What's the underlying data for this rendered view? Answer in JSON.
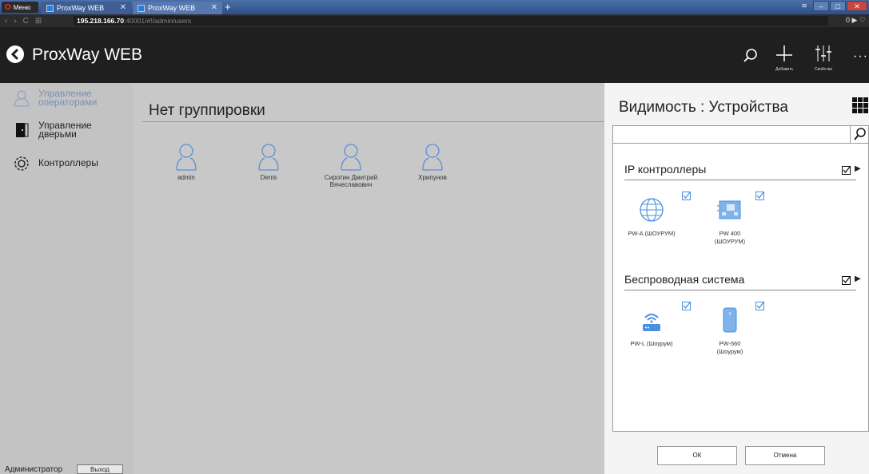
{
  "browser": {
    "menu_label": "Меню",
    "tabs": [
      {
        "title": "ProxWay WEB"
      },
      {
        "title": "ProxWay WEB"
      }
    ],
    "new_tab": "+",
    "address_host": "195.218.166.70",
    "address_rest": ":40001/#!/admin/users",
    "right_status": "0 ▶ ♡"
  },
  "header": {
    "title": "ProxWay WEB",
    "add_caption": "Добавить",
    "props_caption": "Свойства",
    "more": "···"
  },
  "sidebar": {
    "items": [
      {
        "label": "Управление операторами",
        "icon": "user-outline-icon"
      },
      {
        "label": "Управление дверьми",
        "icon": "door-icon"
      },
      {
        "label": "Контроллеры",
        "icon": "gear-icon"
      }
    ],
    "admin_label": "Администратор",
    "logout_label": "Выход"
  },
  "main": {
    "group_title": "Нет группировки",
    "users": [
      {
        "name": "admin"
      },
      {
        "name": "Denis"
      },
      {
        "name": "Сиротин Дмитрий Вячеславович"
      },
      {
        "name": "Хрипунов"
      }
    ]
  },
  "panel": {
    "title": "Видимость : Устройства",
    "search_placeholder": "",
    "sections": [
      {
        "title": "IP контроллеры",
        "devices": [
          {
            "label": "PW-A (ШОУРУМ)",
            "icon": "globe-icon"
          },
          {
            "label": "PW 400 (ШОУРУМ)",
            "icon": "board-icon"
          }
        ]
      },
      {
        "title": "Беспроводная система",
        "devices": [
          {
            "label": "PW-L (Шоурум)",
            "icon": "wifi-router-icon"
          },
          {
            "label": "PW-560 (Шоурум)",
            "icon": "reader-icon"
          }
        ]
      }
    ],
    "ok_label": "ОК",
    "cancel_label": "Отмена"
  },
  "colors": {
    "accent": "#4a90e2",
    "header_bg": "#1f1f1f",
    "sidebar_bg": "#c3c3c3",
    "panel_bg": "#f4f4f4"
  }
}
